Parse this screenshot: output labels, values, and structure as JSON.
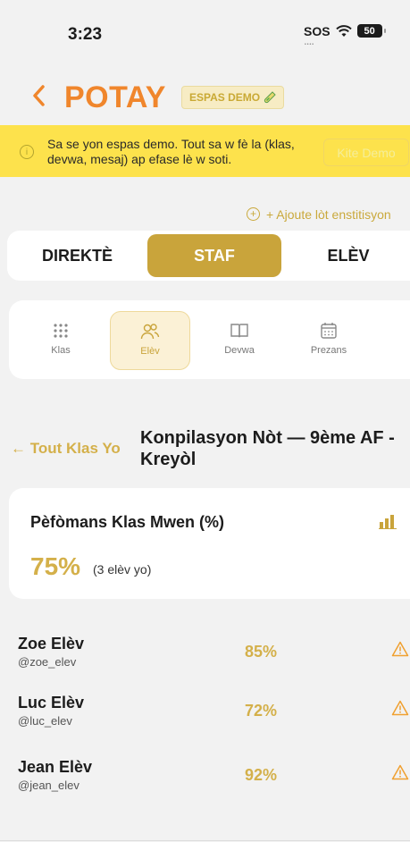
{
  "status": {
    "time": "3:23",
    "sos": "SOS",
    "battery": "50"
  },
  "header": {
    "back_icon": "chevron-left-icon",
    "title": "POTAY",
    "badge": "ESPAS DEMO",
    "badge_icon": "test-tube-icon"
  },
  "banner": {
    "icon": "info-icon",
    "text": "Sa se yon espas demo. Tout sa w fè la (klas, devwa, mesaj) ap efase lè w soti.",
    "button_label": "Kite Demo"
  },
  "add_institution": {
    "icon": "plus-circle-icon",
    "label": "+ Ajoute lòt enstitisyon"
  },
  "role_tabs": [
    {
      "label": "DIREKTÈ",
      "active": false
    },
    {
      "label": "STAF",
      "active": true
    },
    {
      "label": "ELÈV",
      "active": false
    }
  ],
  "sub_tabs": [
    {
      "label": "Klas",
      "icon": "grid-dots-icon",
      "active": false
    },
    {
      "label": "Elèv",
      "icon": "users-icon",
      "active": true
    },
    {
      "label": "Devwa",
      "icon": "book-icon",
      "active": false
    },
    {
      "label": "Prezans",
      "icon": "calendar-icon",
      "active": false
    }
  ],
  "class_header": {
    "back_label": "← Tout Klas Yo",
    "title_line1": "Konpilasyon Nòt — 9ème AF -",
    "title_line2": "Kreyòl"
  },
  "performance": {
    "title": "Pèfòmans Klas Mwen (%)",
    "icon": "bar-chart-icon",
    "value": "75%",
    "count": "(3 elèv yo)"
  },
  "students": [
    {
      "name": "Zoe Elèv",
      "handle": "@zoe_elev",
      "grade": "85%",
      "icon": "warning-icon"
    },
    {
      "name": "Luc Elèv",
      "handle": "@luc_elev",
      "grade": "72%",
      "icon": "warning-icon"
    },
    {
      "name": "Jean Elèv",
      "handle": "@jean_elev",
      "grade": "92%",
      "icon": "warning-icon"
    }
  ],
  "colors": {
    "brand_orange": "#f0862c",
    "gold": "#c9a43b",
    "banner_yellow": "#fde24c",
    "warning_orange": "#f0a030"
  }
}
